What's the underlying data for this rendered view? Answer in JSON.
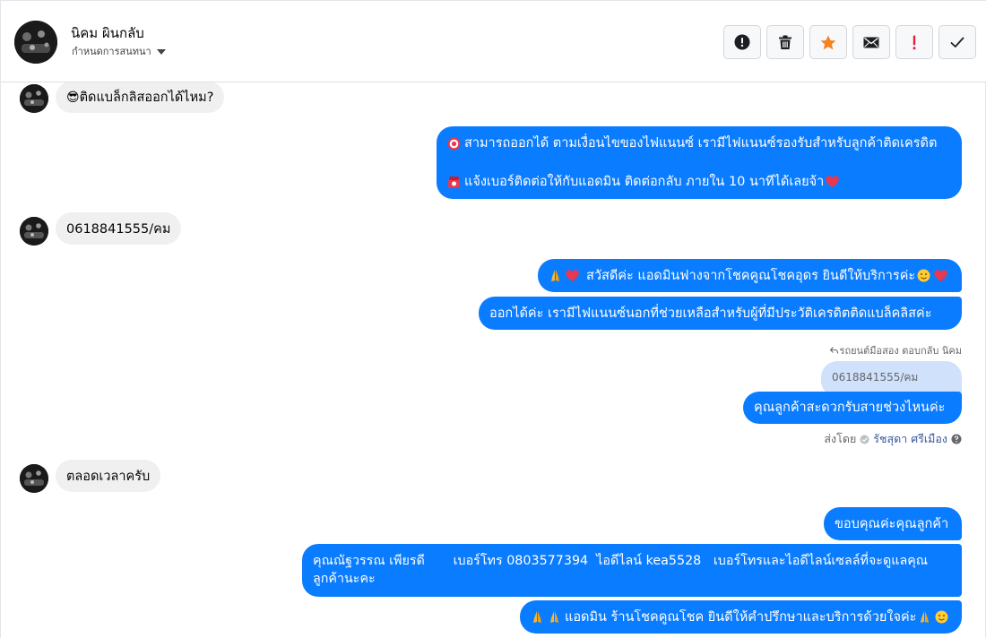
{
  "header": {
    "contact_name": "นิคม ผินกลับ",
    "subtitle": "กำหนดการสนทนา",
    "toolbar": [
      {
        "icon": "alert-circle-icon",
        "color": "#1c1e21"
      },
      {
        "icon": "trash-icon",
        "color": "#1c1e21"
      },
      {
        "icon": "star-icon",
        "color": "#f5821f"
      },
      {
        "icon": "envelope-icon",
        "color": "#1c1e21"
      },
      {
        "icon": "exclamation-icon",
        "color": "#e41e3f"
      },
      {
        "icon": "check-icon",
        "color": "#1c1e21"
      }
    ]
  },
  "colors": {
    "outgoing": "#0a7cff",
    "incoming": "#f0f0f0",
    "quoted": "#cfe1fb"
  },
  "messages": {
    "m1": {
      "emoji": "😎",
      "text": "ติดแบล็กลิสออกได้ไหม?"
    },
    "m2": {
      "line1_emoji": "🎯",
      "line1": "สามารถออกได้ ตามเงื่อนไขของไฟแนนซ์ เรามีไฟแนนซ์รองรับสำหรับลูกค้าติดเครดิต",
      "line2_emoji": "☎",
      "line2": "แจ้งเบอร์ติดต่อให้กับแอดมิน ติดต่อกลับ ภายใน 10 นาทีได้เลยจ้า",
      "line2_end_emoji": "❤"
    },
    "m3": {
      "text": "0618841555/คม"
    },
    "m4": {
      "emoji_a": "🙏",
      "emoji_b": "❤",
      "text": "สวัสดีค่ะ แอดมินฟางจากโชคคูณโชคอุดร ยินดีให้บริการค่ะ",
      "end_a": "🥰",
      "end_b": "❤"
    },
    "m5": {
      "text": "ออกได้ค่ะ เรามีไฟแนนซ์นอกที่ช่วยเหลือสำหรับผู้ที่มีประวัติเครดิตติดแบล็คลิสค่ะ"
    },
    "reply_note": "รถยนต์มือสอง ตอบกลับ นิคม",
    "quoted": "0618841555/คม",
    "m6": {
      "text": "คุณลูกค้าสะดวกรับสายช่วงไหนค่ะ"
    },
    "sent_by": {
      "prefix": "ส่งโดย",
      "agent": "รัชสุดา ศรีเมือง"
    },
    "m7": {
      "text": "ตลอดเวลาครับ"
    },
    "m8": {
      "text": "ขอบคุณค่ะคุณลูกค้า"
    },
    "m9": {
      "line1": "คุณณัฐวรรณ เพียรดี       เบอร์โทร 0803577394  ไอดีไลน์ kea5528   เบอร์โทรและไอดีไลน์เซลล์ที่จะดูแลคุณ",
      "line2": "ลูกค้านะคะ"
    },
    "m10": {
      "emoji": "🙏🙏",
      "text": "แอดมิน ร้านโชคคูณโชค ยินดีให้คำปรึกษาและบริการด้วยใจค่ะ",
      "end": "🙏🥰"
    }
  }
}
